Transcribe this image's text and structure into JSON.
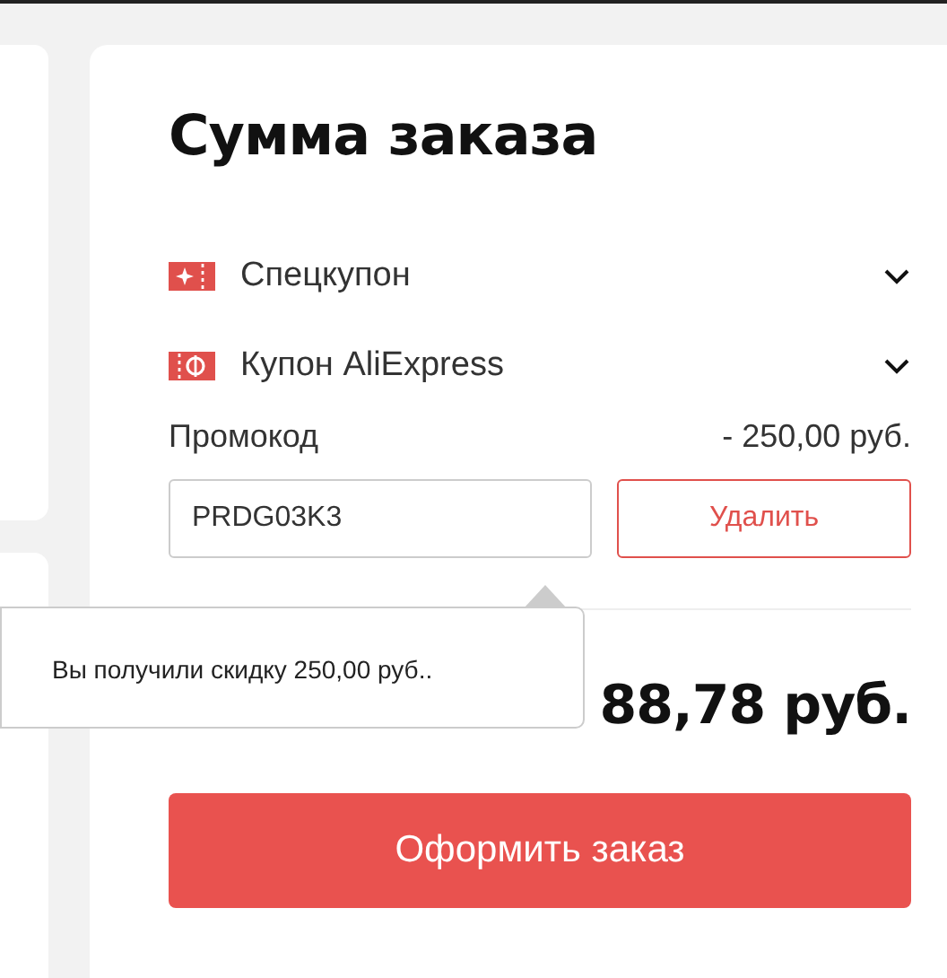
{
  "summary": {
    "title": "Сумма заказа",
    "coupons": [
      {
        "kind": "special",
        "label": "Спецкупон",
        "expanded": false
      },
      {
        "kind": "store",
        "label": "Купон AliExpress",
        "expanded": false
      }
    ],
    "promo": {
      "label": "Промокод",
      "discount": "- 250,00 руб.",
      "value": "PRDG03K3",
      "remove_button": "Удалить"
    },
    "tooltip": "Вы получили скидку 250,00 руб..",
    "total": "88,78 руб.",
    "checkout_button": "Оформить заказ"
  }
}
